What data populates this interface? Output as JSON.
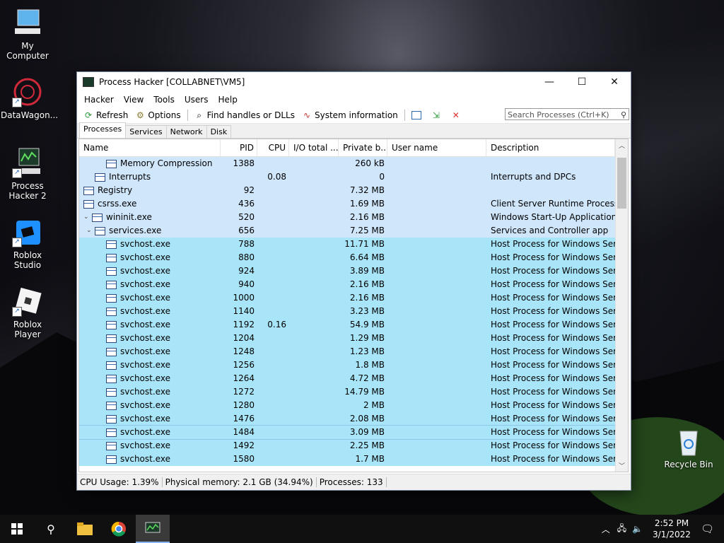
{
  "desktop": {
    "icons": [
      {
        "label": "My Computer"
      },
      {
        "label": "DataWagon..."
      },
      {
        "label": "Process Hacker 2"
      },
      {
        "label": "Roblox Studio"
      },
      {
        "label": "Roblox Player"
      },
      {
        "label": "Recycle Bin"
      }
    ]
  },
  "window": {
    "title": "Process Hacker [COLLABNET\\VM5]",
    "menu": [
      "Hacker",
      "View",
      "Tools",
      "Users",
      "Help"
    ],
    "toolbar": {
      "refresh": "Refresh",
      "options": "Options",
      "find": "Find handles or DLLs",
      "sysinfo": "System information"
    },
    "search_placeholder": "Search Processes (Ctrl+K)",
    "tabs": [
      "Processes",
      "Services",
      "Network",
      "Disk"
    ],
    "columns": [
      "Name",
      "PID",
      "CPU",
      "I/O total ...",
      "Private b...",
      "User name",
      "Description"
    ],
    "rows": [
      {
        "name": "Memory Compression",
        "pid": "1388",
        "cpu": "",
        "priv": "260 kB",
        "desc": ""
      },
      {
        "name": "Interrupts",
        "pid": "",
        "cpu": "0.08",
        "priv": "0",
        "desc": "Interrupts and DPCs"
      },
      {
        "name": "Registry",
        "pid": "92",
        "cpu": "",
        "priv": "7.32 MB",
        "desc": ""
      },
      {
        "name": "csrss.exe",
        "pid": "436",
        "cpu": "",
        "priv": "1.69 MB",
        "desc": "Client Server Runtime Process"
      },
      {
        "name": "wininit.exe",
        "pid": "520",
        "cpu": "",
        "priv": "2.16 MB",
        "desc": "Windows Start-Up Application"
      },
      {
        "name": "services.exe",
        "pid": "656",
        "cpu": "",
        "priv": "7.25 MB",
        "desc": "Services and Controller app"
      },
      {
        "name": "svchost.exe",
        "pid": "788",
        "cpu": "",
        "priv": "11.71 MB",
        "desc": "Host Process for Windows Ser..."
      },
      {
        "name": "svchost.exe",
        "pid": "880",
        "cpu": "",
        "priv": "6.64 MB",
        "desc": "Host Process for Windows Ser..."
      },
      {
        "name": "svchost.exe",
        "pid": "924",
        "cpu": "",
        "priv": "3.89 MB",
        "desc": "Host Process for Windows Ser..."
      },
      {
        "name": "svchost.exe",
        "pid": "940",
        "cpu": "",
        "priv": "2.16 MB",
        "desc": "Host Process for Windows Ser..."
      },
      {
        "name": "svchost.exe",
        "pid": "1000",
        "cpu": "",
        "priv": "2.16 MB",
        "desc": "Host Process for Windows Ser..."
      },
      {
        "name": "svchost.exe",
        "pid": "1140",
        "cpu": "",
        "priv": "3.23 MB",
        "desc": "Host Process for Windows Ser..."
      },
      {
        "name": "svchost.exe",
        "pid": "1192",
        "cpu": "0.16",
        "priv": "54.9 MB",
        "desc": "Host Process for Windows Ser..."
      },
      {
        "name": "svchost.exe",
        "pid": "1204",
        "cpu": "",
        "priv": "1.29 MB",
        "desc": "Host Process for Windows Ser..."
      },
      {
        "name": "svchost.exe",
        "pid": "1248",
        "cpu": "",
        "priv": "1.23 MB",
        "desc": "Host Process for Windows Ser..."
      },
      {
        "name": "svchost.exe",
        "pid": "1256",
        "cpu": "",
        "priv": "1.8 MB",
        "desc": "Host Process for Windows Ser..."
      },
      {
        "name": "svchost.exe",
        "pid": "1264",
        "cpu": "",
        "priv": "4.72 MB",
        "desc": "Host Process for Windows Ser..."
      },
      {
        "name": "svchost.exe",
        "pid": "1272",
        "cpu": "",
        "priv": "14.79 MB",
        "desc": "Host Process for Windows Ser..."
      },
      {
        "name": "svchost.exe",
        "pid": "1280",
        "cpu": "",
        "priv": "2 MB",
        "desc": "Host Process for Windows Ser..."
      },
      {
        "name": "svchost.exe",
        "pid": "1476",
        "cpu": "",
        "priv": "2.08 MB",
        "desc": "Host Process for Windows Ser..."
      },
      {
        "name": "svchost.exe",
        "pid": "1484",
        "cpu": "",
        "priv": "3.09 MB",
        "desc": "Host Process for Windows Ser..."
      },
      {
        "name": "svchost.exe",
        "pid": "1492",
        "cpu": "",
        "priv": "2.25 MB",
        "desc": "Host Process for Windows Ser..."
      },
      {
        "name": "svchost.exe",
        "pid": "1580",
        "cpu": "",
        "priv": "1.7 MB",
        "desc": "Host Process for Windows Ser..."
      }
    ],
    "status": {
      "cpu": "CPU Usage: 1.39%",
      "mem": "Physical memory: 2.1 GB (34.94%)",
      "procs": "Processes: 133"
    }
  },
  "taskbar": {
    "time": "2:52 PM",
    "date": "3/1/2022"
  },
  "colors": {
    "system_row": "#cfe6fb",
    "service_row": "#a9e5f8"
  }
}
